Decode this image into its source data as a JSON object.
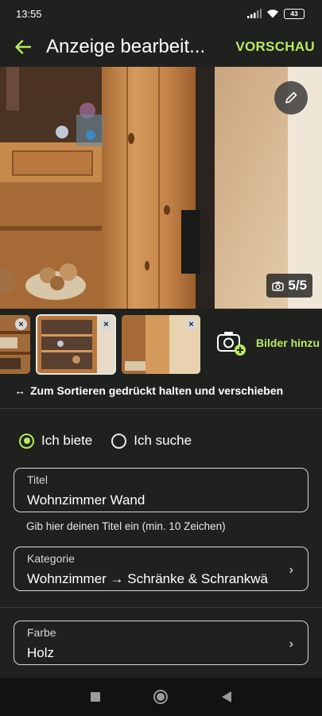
{
  "status": {
    "time": "13:55",
    "battery": "43"
  },
  "appbar": {
    "title": "Anzeige bearbeit...",
    "preview": "VORSCHAU"
  },
  "gallery": {
    "count": "5/5",
    "add_label": "Bilder hinzu"
  },
  "sort_hint": "Zum Sortieren gedrückt halten und verschieben",
  "offer_type": {
    "options": [
      "Ich biete",
      "Ich suche"
    ],
    "selected": "Ich biete"
  },
  "fields": {
    "title": {
      "label": "Titel",
      "value": "Wohnzimmer Wand",
      "helper": "Gib hier deinen Titel ein (min. 10 Zeichen)"
    },
    "category": {
      "label": "Kategorie",
      "value": "Wohnzimmer → Schränke & Schrankwä"
    },
    "color": {
      "label": "Farbe",
      "value": "Holz"
    }
  },
  "colors": {
    "accent": "#b9ea5f",
    "background": "#1f211e"
  }
}
